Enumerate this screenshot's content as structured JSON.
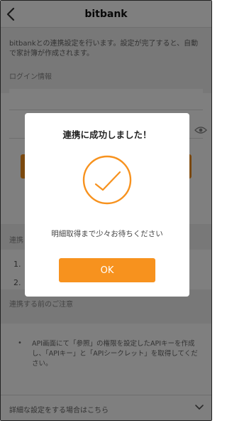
{
  "header": {
    "title": "bitbank"
  },
  "intro": {
    "text": "bitbankとの連携設定を行います。設定が完了すると、自動で家計簿が作成されます。"
  },
  "login": {
    "section_label": "ログイン情報"
  },
  "integration": {
    "section_label": "連携",
    "steps": [
      "1.",
      "2."
    ]
  },
  "notes": {
    "section_label": "連携する前のご注意",
    "bullet": "•",
    "text": "API画面にて「参照」の権限を設定したAPIキーを作成し、「APIキー」と「APIシークレット」を取得してください。"
  },
  "advanced": {
    "label": "詳細な設定をする場合はこちら"
  },
  "modal": {
    "title": "連携に成功しました！",
    "message": "明細取得まで少々お待ちください",
    "ok_label": "OK"
  },
  "colors": {
    "accent": "#f7921e",
    "overlay": "rgba(0,0,0,0.5)"
  }
}
